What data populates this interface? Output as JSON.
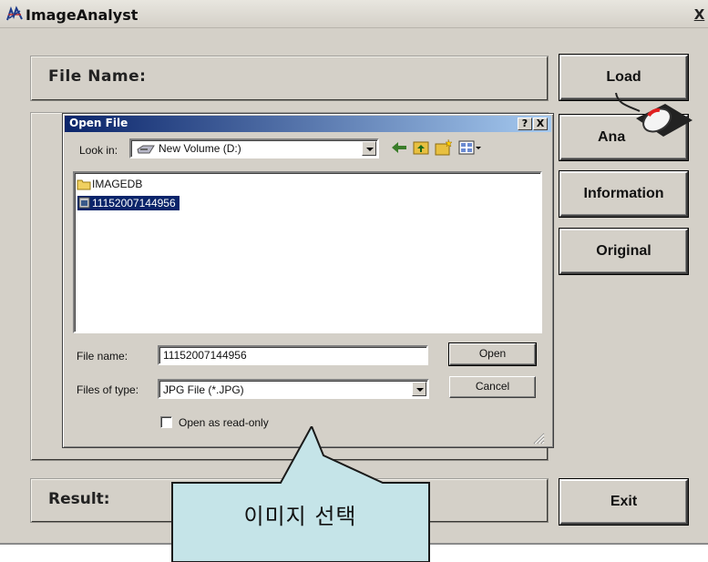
{
  "window": {
    "title": "ImageAnalyst",
    "close_label": "X"
  },
  "panels": {
    "file_name_label": "File Name:",
    "result_label": "Result:"
  },
  "side_buttons": {
    "load": "Load",
    "analysis": "Ana",
    "information": "Information",
    "original": "Original",
    "exit": "Exit"
  },
  "dialog": {
    "title": "Open File",
    "help_label": "?",
    "close_label": "X",
    "look_in_label": "Look in:",
    "look_in_value": "New Volume (D:)",
    "items": [
      {
        "name": "IMAGEDB",
        "icon": "folder-icon"
      },
      {
        "name": "11152007144956",
        "icon": "image-file-icon",
        "selected": true
      }
    ],
    "file_name_label": "File name:",
    "file_name_value": "11152007144956",
    "file_type_label": "Files of type:",
    "file_type_value": "JPG File (*.JPG)",
    "open_label": "Open",
    "cancel_label": "Cancel",
    "readonly_label": "Open as read-only",
    "readonly_checked": false
  },
  "callout": {
    "text": "이미지 선택"
  },
  "colors": {
    "window_bg": "#d4d0c8",
    "dialog_titlebar": "#0a246a",
    "selection": "#0a246a",
    "callout_fill": "#c5e4e8",
    "mouse_accent": "#e02020"
  }
}
